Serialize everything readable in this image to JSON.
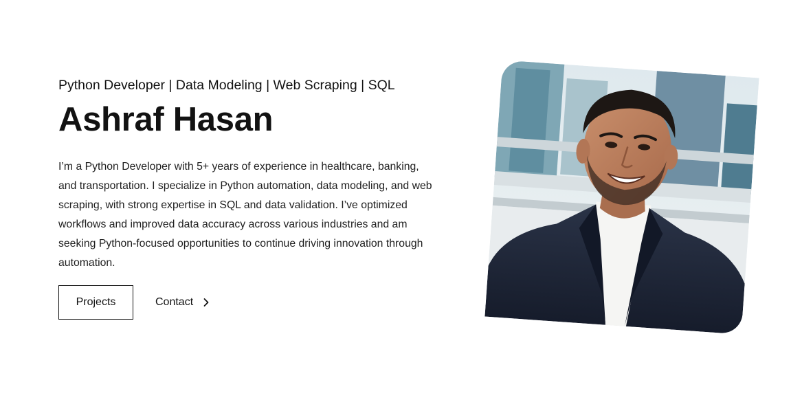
{
  "hero": {
    "tagline": "Python Developer | Data Modeling | Web Scraping | SQL",
    "name": "Ashraf Hasan",
    "bio": "I’m a Python Developer with 5+ years of experience in healthcare, banking, and transportation. I specialize in Python automation, data modeling, and web scraping, with strong expertise in SQL and data validation. I’ve optimized workflows and improved data accuracy across various industries and am seeking Python-focused opportunities to continue driving innovation through automation.",
    "buttons": {
      "projects_label": "Projects",
      "contact_label": "Contact",
      "contact_icon": "chevron-right-icon"
    },
    "photo": {
      "subject": "portrait-photo"
    }
  },
  "colors": {
    "text": "#111111",
    "background": "#ffffff",
    "suit": "#1c2436",
    "shirt": "#f5f5f3"
  }
}
